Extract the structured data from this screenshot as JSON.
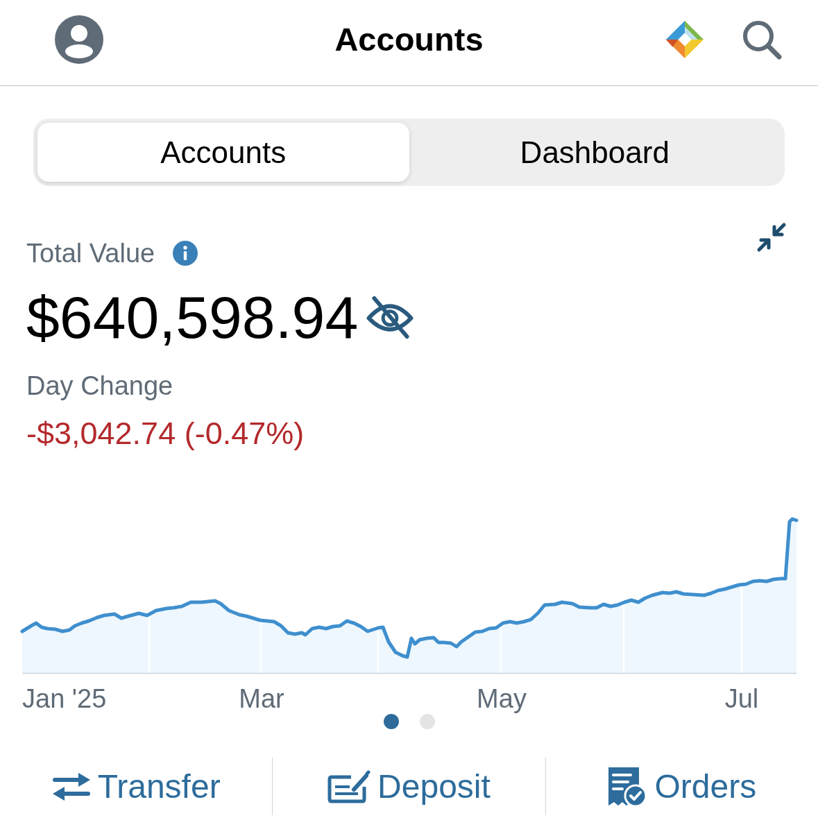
{
  "header": {
    "title": "Accounts"
  },
  "segments": [
    {
      "label": "Accounts",
      "selected": true
    },
    {
      "label": "Dashboard",
      "selected": false
    }
  ],
  "summary": {
    "total_label": "Total Value",
    "total_value": "$640,598.94",
    "day_change_label": "Day Change",
    "day_change": "-$3,042.74 (-0.47%)",
    "negative": true
  },
  "chart": {
    "x_labels": [
      "Jan '25",
      "Mar",
      "May",
      "Jul"
    ]
  },
  "pager": [
    {
      "selected": true
    },
    {
      "selected": false
    }
  ],
  "actions": [
    {
      "kind": "transfer",
      "label": "Transfer"
    },
    {
      "kind": "deposit",
      "label": "Deposit"
    },
    {
      "kind": "orders",
      "label": "Orders"
    }
  ]
}
